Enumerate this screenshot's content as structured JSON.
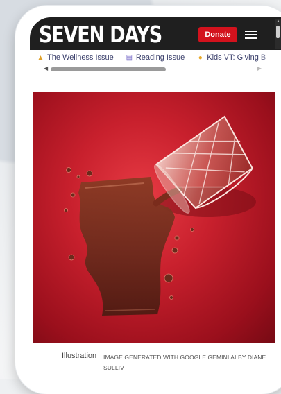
{
  "header": {
    "logo_text": "SEVEN DAYS",
    "donate_label": "Donate",
    "menu_icon": "hamburger-icon"
  },
  "issues": [
    {
      "icon": "figure-icon",
      "label": "The Wellness Issue"
    },
    {
      "icon": "books-icon",
      "label": "Reading Issue"
    },
    {
      "icon": "sun-icon",
      "label": "Kids VT: Giving B"
    }
  ],
  "hero_image": {
    "subject": "spilled-glass-illustration"
  },
  "caption": {
    "label": "Illustration",
    "credit": "IMAGE GENERATED WITH GOOGLE GEMINI AI BY DIANE SULLIV"
  },
  "colors": {
    "topbar": "#1f1f1f",
    "donate": "#d3121d",
    "hero_red": "#c8202d",
    "liquid": "#6b2a1c",
    "link": "#3a3f6b"
  }
}
